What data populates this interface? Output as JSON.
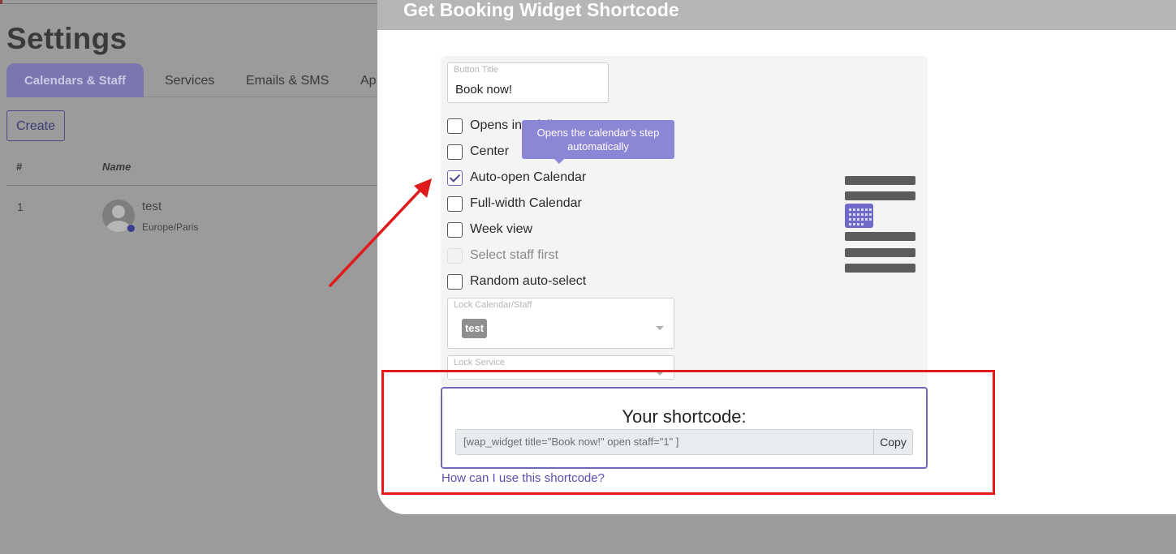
{
  "background": {
    "page_title": "Settings",
    "tabs": [
      "Calendars & Staff",
      "Services",
      "Emails & SMS",
      "Ap"
    ],
    "create_button": "Create",
    "table": {
      "headers": [
        "#",
        "Name"
      ],
      "rows": [
        {
          "index": "1",
          "name": "test",
          "timezone": "Europe/Paris"
        }
      ]
    }
  },
  "modal": {
    "title": "Get Booking Widget Shortcode",
    "button_title_label": "Button Title",
    "button_title_value": "Book now!",
    "options": [
      {
        "label": "Opens in a full screen popup",
        "checked": false,
        "disabled": false
      },
      {
        "label": "Center",
        "checked": false,
        "disabled": false
      },
      {
        "label": "Auto-open Calendar",
        "checked": true,
        "disabled": false
      },
      {
        "label": "Full-width Calendar",
        "checked": false,
        "disabled": false
      },
      {
        "label": "Week view",
        "checked": false,
        "disabled": false
      },
      {
        "label": "Select staff first",
        "checked": false,
        "disabled": true
      },
      {
        "label": "Random auto-select",
        "checked": false,
        "disabled": false
      }
    ],
    "tooltip": "Opens the calendar's step automatically",
    "lock_calendar_label": "Lock Calendar/Staff",
    "lock_calendar_tag": "test",
    "lock_service_label": "Lock Service",
    "shortcode_title": "Your shortcode:",
    "shortcode_value": "[wap_widget title=\"Book now!\" open  staff=\"1\" ]",
    "copy_label": "Copy",
    "help_link": "How can I use this shortcode?"
  },
  "icons": {
    "layout_preview": "widget-layout-icon",
    "calendar": "calendar-grid-icon"
  },
  "colors": {
    "accent": "#6e6ab9",
    "annotation": "#e01b1b",
    "tooltip": "#8b86d6"
  }
}
